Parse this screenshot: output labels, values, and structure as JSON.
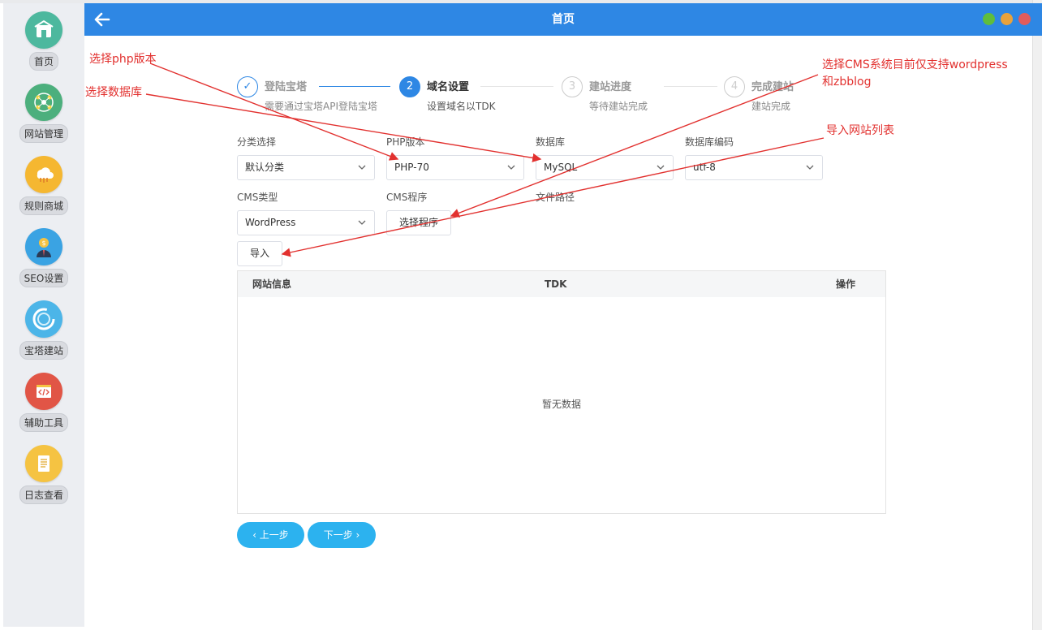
{
  "window": {
    "title": "首页",
    "back_icon": "arrow-left-icon",
    "controls": [
      {
        "name": "minimize",
        "color": "#5fbd3d"
      },
      {
        "name": "maximize",
        "color": "#e9a23b"
      },
      {
        "name": "close",
        "color": "#e25c5c"
      }
    ]
  },
  "sidebar": {
    "items": [
      {
        "label": "首页",
        "icon": "home-icon",
        "color": "#4db89e"
      },
      {
        "label": "网站管理",
        "icon": "network-icon",
        "color": "#4caf7d"
      },
      {
        "label": "规则商城",
        "icon": "cloud-shop-icon",
        "color": "#f5b731"
      },
      {
        "label": "SEO设置",
        "icon": "user-dollar-icon",
        "color": "#3aa3e3"
      },
      {
        "label": "宝塔建站",
        "icon": "circle-build-icon",
        "color": "#4cb5e8"
      },
      {
        "label": "辅助工具",
        "icon": "code-tool-icon",
        "color": "#e15546"
      },
      {
        "label": "日志查看",
        "icon": "log-document-icon",
        "color": "#f5c342"
      }
    ]
  },
  "steps": [
    {
      "num": "✓",
      "title": "登陆宝塔",
      "desc": "需要通过宝塔API登陆宝塔",
      "state": "done"
    },
    {
      "num": "2",
      "title": "域名设置",
      "desc": "设置域名以TDK",
      "state": "active"
    },
    {
      "num": "3",
      "title": "建站进度",
      "desc": "等待建站完成",
      "state": "pending"
    },
    {
      "num": "4",
      "title": "完成建站",
      "desc": "建站完成",
      "state": "pending"
    }
  ],
  "form": {
    "category_label": "分类选择",
    "category_value": "默认分类",
    "php_label": "PHP版本",
    "php_value": "PHP-70",
    "db_label": "数据库",
    "db_value": "MySQL",
    "db_encoding_label": "数据库编码",
    "db_encoding_value": "utf-8",
    "cms_type_label": "CMS类型",
    "cms_type_value": "WordPress",
    "cms_program_label": "CMS程序",
    "cms_program_button": "选择程序",
    "file_path_label": "文件路径",
    "import_button": "导入"
  },
  "table": {
    "columns": [
      "网站信息",
      "TDK",
      "操作"
    ],
    "empty_text": "暂无数据"
  },
  "nav": {
    "prev": "‹ 上一步",
    "next": "下一步 ›"
  },
  "annotations": {
    "php": "选择php版本",
    "database": "选择数据库",
    "cms_line1": "选择CMS系统目前仅支持wordpress",
    "cms_line2": "和zbblog",
    "import": "导入网站列表",
    "color": "#e2312f"
  }
}
